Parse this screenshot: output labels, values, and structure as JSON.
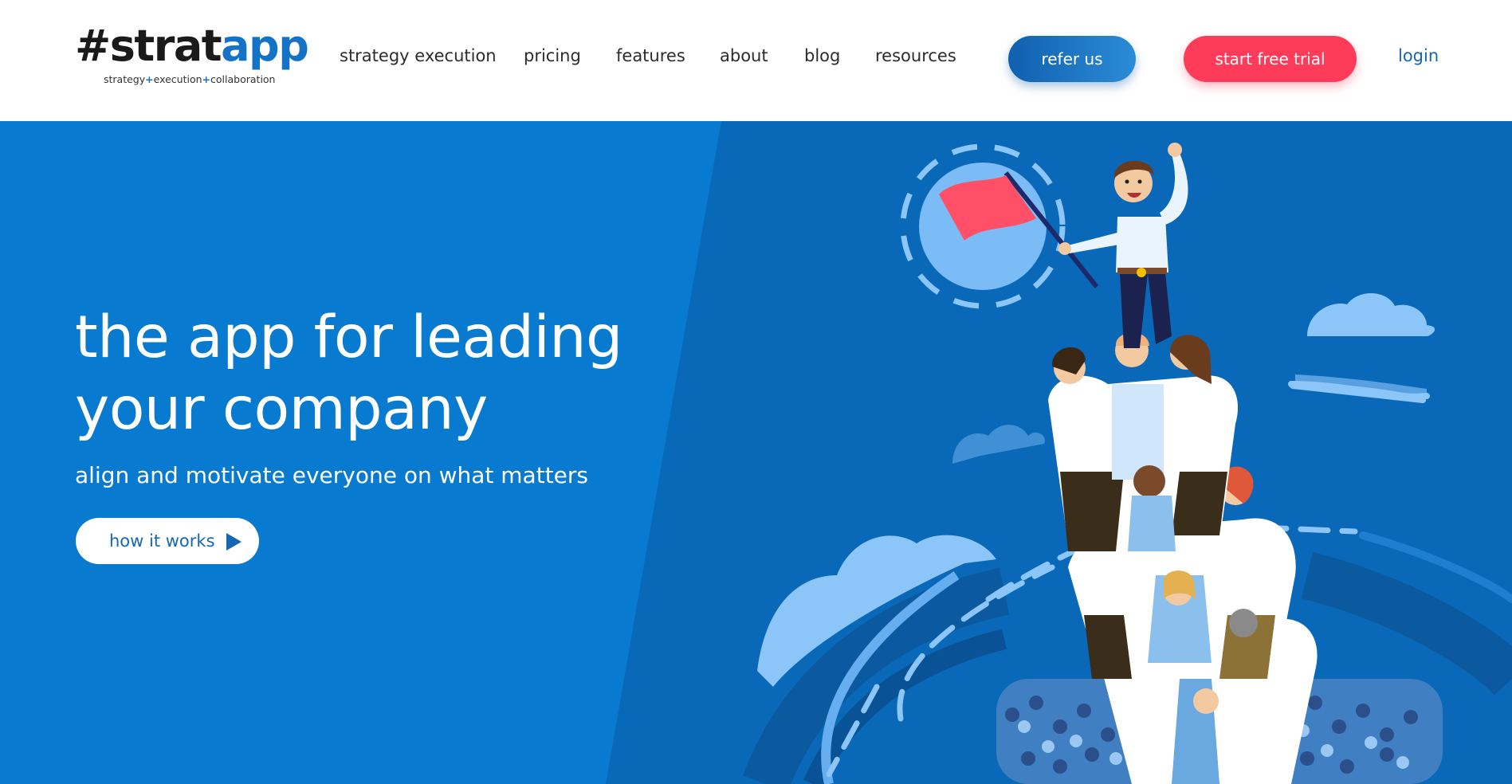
{
  "logo": {
    "word_dark": "#strat",
    "word_blue": "app",
    "tagline_parts": [
      "strategy",
      "+",
      "execution",
      "+",
      "collaboration"
    ]
  },
  "nav": {
    "items": [
      {
        "label": "strategy execution"
      },
      {
        "label": "pricing"
      },
      {
        "label": "features"
      },
      {
        "label": "about"
      },
      {
        "label": "blog"
      },
      {
        "label": "resources"
      }
    ],
    "refer_label": "refer us",
    "trial_label": "start free trial",
    "login_label": "login"
  },
  "hero": {
    "title_line1": "the app for leading",
    "title_line2": "your company",
    "subtitle": "align and motivate everyone on what matters",
    "how_label": "how it works"
  },
  "icons": {
    "how_button": "play-icon",
    "illustration": "team-tower-flag-illustration"
  },
  "colors": {
    "brand_blue": "#1473c6",
    "hero_left": "#087ad0",
    "hero_right": "#0a68b8",
    "trial_red": "#ff3b5a",
    "flag_red": "#ff5068"
  }
}
